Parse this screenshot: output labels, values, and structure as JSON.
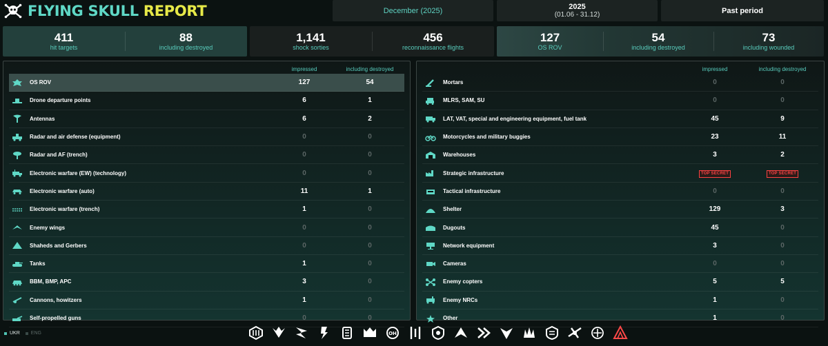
{
  "brand": {
    "title_part1": "FLYING SKULL",
    "title_part2": "REPORT",
    "logo_icon": "skull-crossed-bones-icon"
  },
  "period_buttons": {
    "month": "December (2025)",
    "year": "2025",
    "year_range": "(01.06 - 31.12)",
    "past": "Past period"
  },
  "stats": [
    {
      "value": "411",
      "label": "hit targets"
    },
    {
      "value": "88",
      "label": "including destroyed"
    },
    {
      "value": "1,141",
      "label": "shock sorties"
    },
    {
      "value": "456",
      "label": "reconnaissance flights"
    },
    {
      "value": "127",
      "label": "OS ROV"
    },
    {
      "value": "54",
      "label": "including destroyed"
    },
    {
      "value": "73",
      "label": "including wounded"
    }
  ],
  "columns": {
    "impressed": "impressed",
    "destroyed": "including destroyed"
  },
  "left_rows": [
    {
      "name": "OS ROV",
      "impressed": "127",
      "destroyed": "54",
      "icon": "soldier-icon",
      "highlight": true
    },
    {
      "name": "Drone departure points",
      "impressed": "6",
      "destroyed": "1",
      "icon": "launch-pad-icon"
    },
    {
      "name": "Antennas",
      "impressed": "6",
      "destroyed": "2",
      "icon": "antenna-icon"
    },
    {
      "name": "Radar and air defense (equipment)",
      "impressed": "0",
      "destroyed": "0",
      "icon": "radar-vehicle-icon"
    },
    {
      "name": "Radar and AF (trench)",
      "impressed": "0",
      "destroyed": "0",
      "icon": "radar-dish-icon"
    },
    {
      "name": "Electronic warfare (EW) (technology)",
      "impressed": "0",
      "destroyed": "0",
      "icon": "ew-truck-icon"
    },
    {
      "name": "Electronic warfare (auto)",
      "impressed": "11",
      "destroyed": "1",
      "icon": "ew-car-icon"
    },
    {
      "name": "Electronic warfare (trench)",
      "impressed": "1",
      "destroyed": "0",
      "icon": "ew-trench-icon"
    },
    {
      "name": "Enemy wings",
      "impressed": "0",
      "destroyed": "0",
      "icon": "wing-icon"
    },
    {
      "name": "Shaheds and Gerbers",
      "impressed": "0",
      "destroyed": "0",
      "icon": "shahed-drone-icon"
    },
    {
      "name": "Tanks",
      "impressed": "1",
      "destroyed": "0",
      "icon": "tank-icon"
    },
    {
      "name": "BBM, BMP, APC",
      "impressed": "3",
      "destroyed": "0",
      "icon": "apc-icon"
    },
    {
      "name": "Cannons, howitzers",
      "impressed": "1",
      "destroyed": "0",
      "icon": "howitzer-icon"
    },
    {
      "name": "Self-propelled guns",
      "impressed": "0",
      "destroyed": "0",
      "icon": "spg-icon"
    }
  ],
  "right_rows": [
    {
      "name": "Mortars",
      "impressed": "0",
      "destroyed": "0",
      "icon": "mortar-icon"
    },
    {
      "name": "MLRS, SAM, SU",
      "impressed": "0",
      "destroyed": "0",
      "icon": "mlrs-icon"
    },
    {
      "name": "LAT, VAT, special and engineering equipment, fuel tank",
      "impressed": "45",
      "destroyed": "9",
      "icon": "truck-icon"
    },
    {
      "name": "Motorcycles and military buggies",
      "impressed": "23",
      "destroyed": "11",
      "icon": "motorcycle-icon"
    },
    {
      "name": "Warehouses",
      "impressed": "3",
      "destroyed": "2",
      "icon": "warehouse-icon"
    },
    {
      "name": "Strategic infrastructure",
      "impressed": "TOP SECRET",
      "destroyed": "TOP SECRET",
      "icon": "factory-icon"
    },
    {
      "name": "Tactical infrastructure",
      "impressed": "0",
      "destroyed": "0",
      "icon": "bunker-icon"
    },
    {
      "name": "Shelter",
      "impressed": "129",
      "destroyed": "3",
      "icon": "shelter-icon"
    },
    {
      "name": "Dugouts",
      "impressed": "45",
      "destroyed": "0",
      "icon": "dugout-icon"
    },
    {
      "name": "Network equipment",
      "impressed": "3",
      "destroyed": "0",
      "icon": "network-icon"
    },
    {
      "name": "Cameras",
      "impressed": "0",
      "destroyed": "0",
      "icon": "camera-icon"
    },
    {
      "name": "Enemy copters",
      "impressed": "5",
      "destroyed": "5",
      "icon": "quadcopter-icon"
    },
    {
      "name": "Enemy NRCs",
      "impressed": "1",
      "destroyed": "0",
      "icon": "ground-robot-icon"
    },
    {
      "name": "Other",
      "impressed": "1",
      "destroyed": "0",
      "icon": "other-icon"
    }
  ],
  "languages": [
    {
      "code": "UKR",
      "active": true
    },
    {
      "code": "ENG",
      "active": false
    }
  ],
  "unit_logos": [
    "unit-logo-1-icon",
    "unit-logo-2-icon",
    "unit-logo-3-icon",
    "unit-logo-4-icon",
    "unit-logo-5-icon",
    "unit-logo-6-icon",
    "unit-logo-7-icon",
    "unit-logo-8-icon",
    "unit-logo-9-icon",
    "unit-logo-10-icon",
    "unit-logo-11-icon",
    "unit-logo-12-icon",
    "unit-logo-13-icon",
    "unit-logo-14-icon",
    "unit-logo-15-icon",
    "unit-logo-16-icon",
    "unit-logo-17-icon",
    "unit-logo-18-icon"
  ],
  "colors": {
    "accent": "#5fd8c6",
    "brand_yellow": "#e7e948",
    "zero_value": "#5b6665",
    "secret_red": "#ff4242"
  }
}
